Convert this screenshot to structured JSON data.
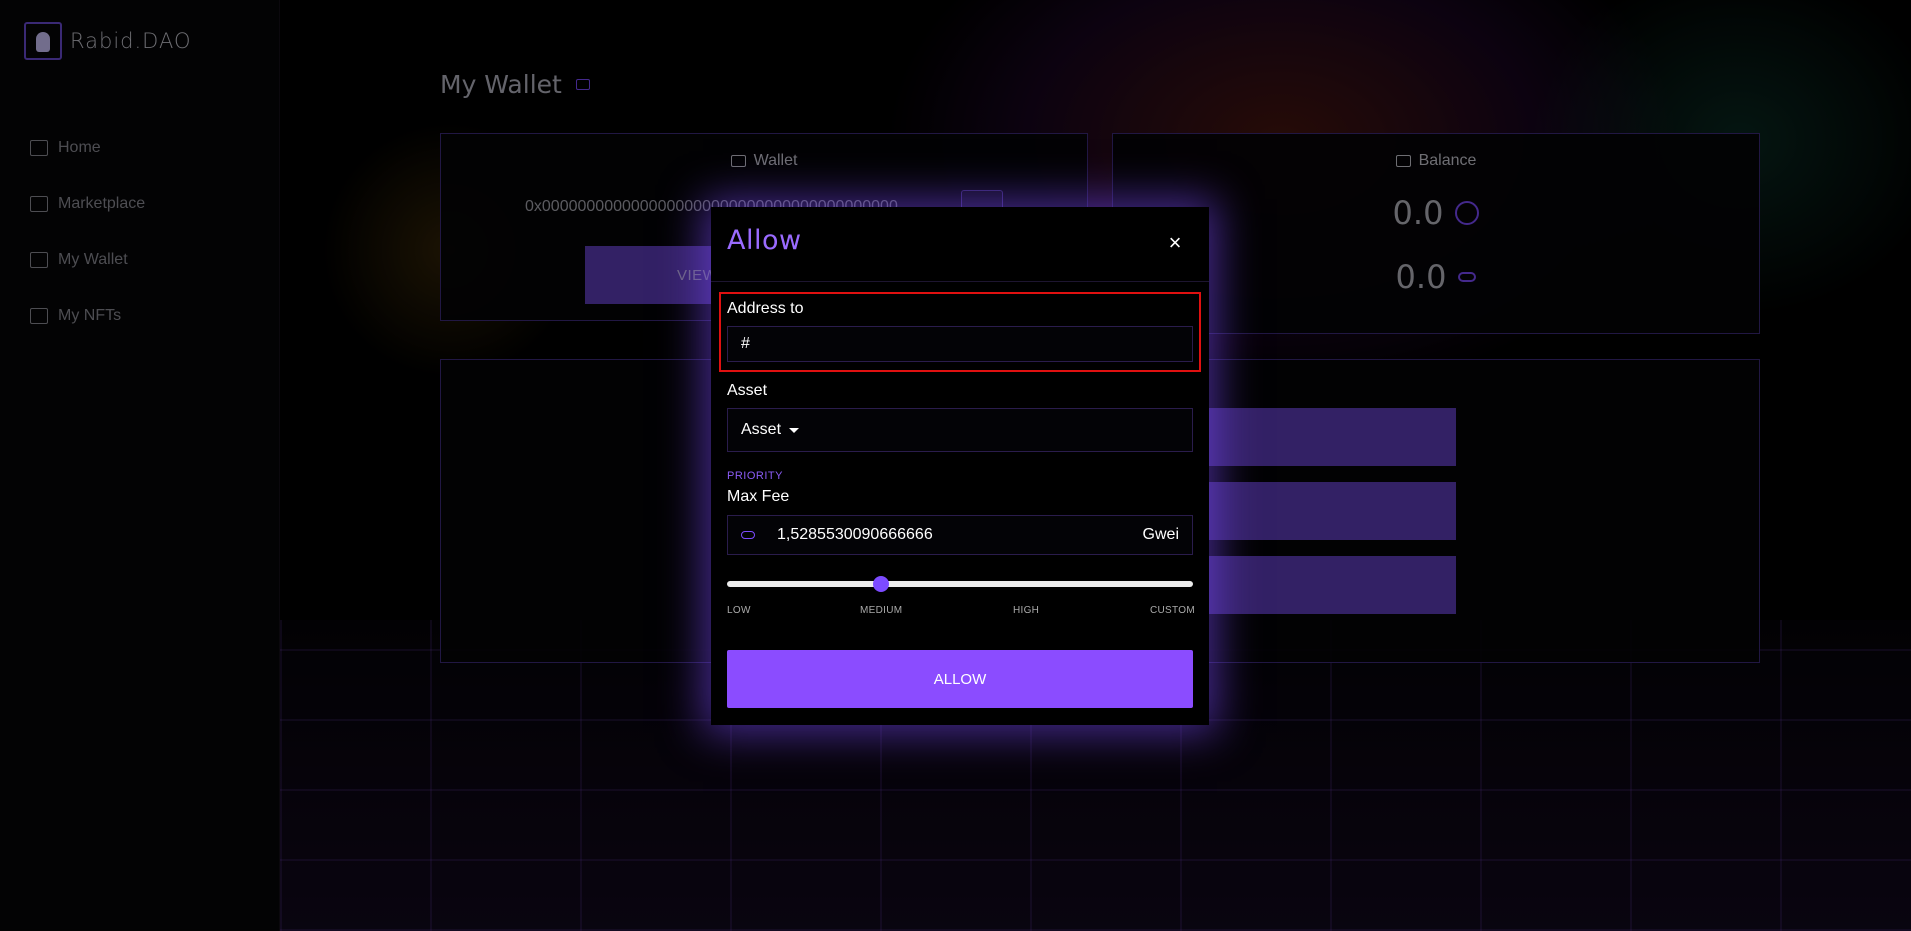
{
  "brand": {
    "name": "Rabid.DAO"
  },
  "sidebar": {
    "items": [
      {
        "label": "Home",
        "icon": "home-icon"
      },
      {
        "label": "Marketplace",
        "icon": "bag-icon"
      },
      {
        "label": "My Wallet",
        "icon": "wallet-icon"
      },
      {
        "label": "My NFTs",
        "icon": "nft-grid-icon"
      }
    ]
  },
  "page": {
    "title": "My Wallet"
  },
  "wallet_card": {
    "title": "Wallet",
    "address": "0x0000000000000000000000000000000000000000",
    "view_label": "VIEW"
  },
  "balance_card": {
    "title": "Balance",
    "primary": "0.0",
    "secondary": "0.0"
  },
  "modal": {
    "title": "Allow",
    "close": "×",
    "address_label": "Address to",
    "address_value": "#",
    "asset_label": "Asset",
    "asset_value": "Asset",
    "priority_label": "PRIORITY",
    "fee_label": "Max Fee",
    "fee_value": "1,5285530090666666",
    "fee_unit": "Gwei",
    "slider": {
      "position_fraction": 0.33,
      "ticks": [
        "LOW",
        "MEDIUM",
        "HIGH",
        "CUSTOM"
      ]
    },
    "submit_label": "ALLOW"
  },
  "colors": {
    "accent": "#8b4cff",
    "highlight": "#e01010"
  }
}
